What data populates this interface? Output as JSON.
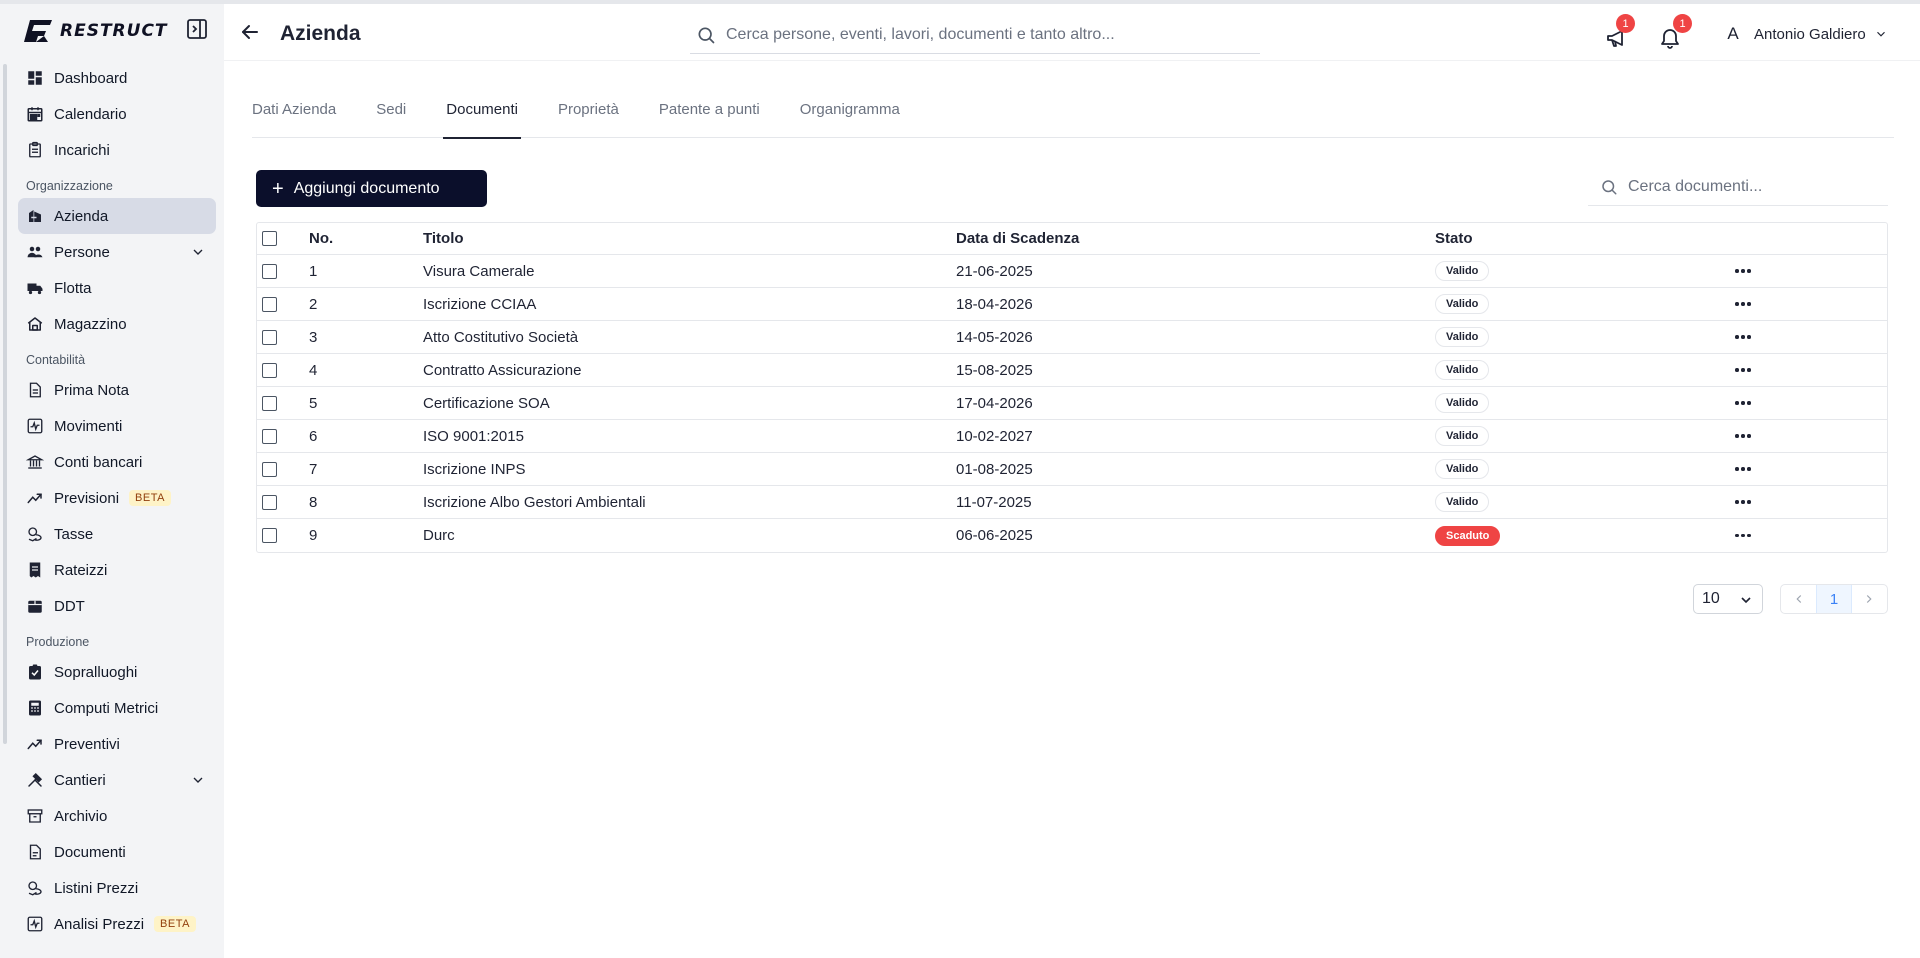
{
  "brand": {
    "name": "RESTRUCT"
  },
  "sidebar": {
    "items": [
      {
        "type": "item",
        "label": "Dashboard",
        "icon": "dashboard-icon"
      },
      {
        "type": "item",
        "label": "Calendario",
        "icon": "calendar-icon"
      },
      {
        "type": "item",
        "label": "Incarichi",
        "icon": "clipboard-icon"
      },
      {
        "type": "section",
        "label": "Organizzazione"
      },
      {
        "type": "item",
        "label": "Azienda",
        "icon": "company-icon",
        "active": true
      },
      {
        "type": "item",
        "label": "Persone",
        "icon": "people-icon",
        "expandable": true
      },
      {
        "type": "item",
        "label": "Flotta",
        "icon": "truck-icon"
      },
      {
        "type": "item",
        "label": "Magazzino",
        "icon": "warehouse-icon"
      },
      {
        "type": "section",
        "label": "Contabilità"
      },
      {
        "type": "item",
        "label": "Prima Nota",
        "icon": "note-icon"
      },
      {
        "type": "item",
        "label": "Movimenti",
        "icon": "activity-icon"
      },
      {
        "type": "item",
        "label": "Conti bancari",
        "icon": "bank-icon"
      },
      {
        "type": "item",
        "label": "Previsioni",
        "icon": "trend-icon",
        "badge": "BETA"
      },
      {
        "type": "item",
        "label": "Tasse",
        "icon": "coins-icon"
      },
      {
        "type": "item",
        "label": "Rateizzi",
        "icon": "receipt-icon"
      },
      {
        "type": "item",
        "label": "DDT",
        "icon": "box-icon"
      },
      {
        "type": "section",
        "label": "Produzione"
      },
      {
        "type": "item",
        "label": "Sopralluoghi",
        "icon": "clipboard-check-icon"
      },
      {
        "type": "item",
        "label": "Computi Metrici",
        "icon": "calculator-icon"
      },
      {
        "type": "item",
        "label": "Preventivi",
        "icon": "trend-icon"
      },
      {
        "type": "item",
        "label": "Cantieri",
        "icon": "tools-icon",
        "expandable": true
      },
      {
        "type": "item",
        "label": "Archivio",
        "icon": "archive-icon"
      },
      {
        "type": "item",
        "label": "Documenti",
        "icon": "document-icon"
      },
      {
        "type": "item",
        "label": "Listini Prezzi",
        "icon": "coins-icon"
      },
      {
        "type": "item",
        "label": "Analisi Prezzi",
        "icon": "activity-icon",
        "badge": "BETA"
      }
    ]
  },
  "header": {
    "title": "Azienda",
    "search_placeholder": "Cerca persone, eventi, lavori, documenti e tanto altro...",
    "announcements_count": "1",
    "notifications_count": "1",
    "user_initial": "A",
    "user_name": "Antonio Galdiero"
  },
  "tabs": [
    {
      "label": "Dati Azienda",
      "active": false
    },
    {
      "label": "Sedi",
      "active": false
    },
    {
      "label": "Documenti",
      "active": true
    },
    {
      "label": "Proprietà",
      "active": false
    },
    {
      "label": "Patente a punti",
      "active": false
    },
    {
      "label": "Organigramma",
      "active": false
    }
  ],
  "toolbar": {
    "add_label": "Aggiungi documento",
    "search_placeholder": "Cerca documenti..."
  },
  "table": {
    "columns": {
      "no": "No.",
      "title": "Titolo",
      "date": "Data di Scadenza",
      "state": "Stato"
    },
    "rows": [
      {
        "no": "1",
        "title": "Visura Camerale",
        "date": "21-06-2025",
        "state": "Valido",
        "expired": false
      },
      {
        "no": "2",
        "title": "Iscrizione CCIAA",
        "date": "18-04-2026",
        "state": "Valido",
        "expired": false
      },
      {
        "no": "3",
        "title": "Atto Costitutivo Società",
        "date": "14-05-2026",
        "state": "Valido",
        "expired": false
      },
      {
        "no": "4",
        "title": "Contratto Assicurazione",
        "date": "15-08-2025",
        "state": "Valido",
        "expired": false
      },
      {
        "no": "5",
        "title": "Certificazione SOA",
        "date": "17-04-2026",
        "state": "Valido",
        "expired": false
      },
      {
        "no": "6",
        "title": "ISO 9001:2015",
        "date": "10-02-2027",
        "state": "Valido",
        "expired": false
      },
      {
        "no": "7",
        "title": "Iscrizione INPS",
        "date": "01-08-2025",
        "state": "Valido",
        "expired": false
      },
      {
        "no": "8",
        "title": "Iscrizione Albo Gestori Ambientali",
        "date": "11-07-2025",
        "state": "Valido",
        "expired": false
      },
      {
        "no": "9",
        "title": "Durc",
        "date": "06-06-2025",
        "state": "Scaduto",
        "expired": true
      }
    ]
  },
  "pagination": {
    "page_size": "10",
    "current_page": "1"
  },
  "colors": {
    "primary": "#0b0f2b",
    "active_nav": "#d7dbe6",
    "danger": "#ef4444",
    "beta_bg": "#fef3c7"
  }
}
